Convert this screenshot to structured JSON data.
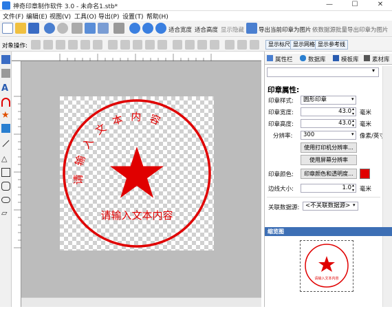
{
  "window": {
    "title": "神奇印章制作软件 3.0 - 未命名1.stb*",
    "minimize": "—",
    "maximize": "☐",
    "close": "✕"
  },
  "menu": [
    "文件(F)",
    "编辑(E)",
    "视图(V)",
    "工具(O)",
    "导出(P)",
    "设置(T)",
    "帮助(H)"
  ],
  "toolbar": {
    "fit_width": "适合宽度",
    "fit_height": "适合高度",
    "show_hide": "显示隐藏",
    "export_image": "导出当前印章为图片",
    "bind_export": "依数据源批量导出印章为图片"
  },
  "toolbar2": {
    "label": "对象操作:",
    "show_ruler": "显示标尺",
    "show_grid": "显示网格",
    "show_guides": "显示参考线"
  },
  "panel": {
    "tabs": [
      "属性栏",
      "数据库",
      "模板库",
      "素材库"
    ],
    "heading": "印章属性:",
    "style_label": "印章样式:",
    "style_value": "圆形印章",
    "width_label": "印章宽度:",
    "width_value": "43.0",
    "width_unit": "毫米",
    "height_label": "印章高度:",
    "height_value": "43.0",
    "height_unit": "毫米",
    "dpi_label": "分辨率:",
    "dpi_value": "300",
    "dpi_unit": "像素/英寸",
    "btn_printer_dpi": "使用打印机分辨率...",
    "btn_screen_dpi": "使用屏幕分辨率",
    "color_label": "印章颜色:",
    "btn_color": "印章颜色和透明度...",
    "stamp_color": "#e00000",
    "border_label": "边线大小:",
    "border_value": "1.0",
    "border_unit": "毫米",
    "datasource_label": "关联数据源:",
    "datasource_value": "<不关联数据源>",
    "thumb_title": "缩览图"
  },
  "stamp": {
    "arc_text": "请输入文本内容",
    "bottom_text": "请输入文本内容",
    "color": "#e00000"
  }
}
